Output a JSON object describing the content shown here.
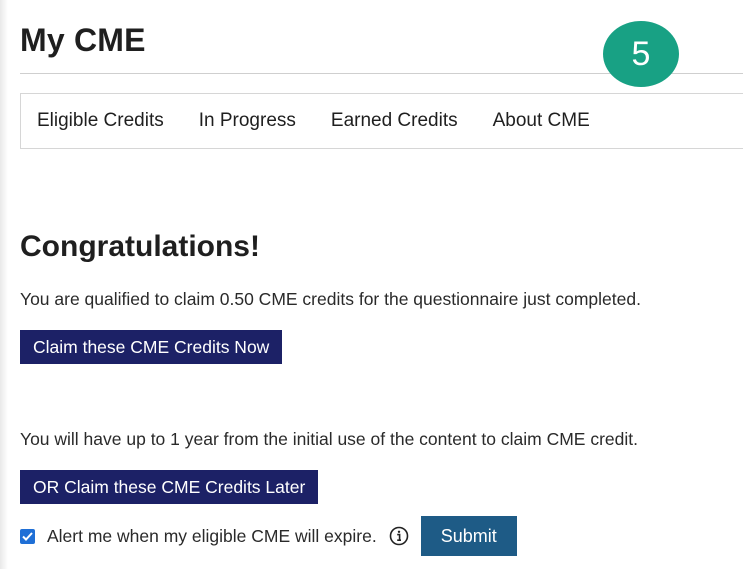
{
  "header": {
    "title": "My CME",
    "step_badge": "5"
  },
  "tabs": [
    {
      "label": "Eligible Credits"
    },
    {
      "label": "In Progress"
    },
    {
      "label": "Earned Credits"
    },
    {
      "label": "About CME"
    }
  ],
  "main": {
    "heading": "Congratulations!",
    "qualified_text": "You are qualified to claim 0.50 CME credits for the questionnaire just completed.",
    "claim_now_label": "Claim these CME Credits Now",
    "year_text": "You will have up to 1 year from the initial use of the content to claim CME credit.",
    "claim_later_label": "OR Claim these CME Credits Later",
    "alert_label": "Alert me when my eligible CME will expire.",
    "alert_checked": true,
    "submit_label": "Submit"
  },
  "icons": {
    "info": "info-circle-icon",
    "checkbox_check": "checkmark-icon"
  },
  "colors": {
    "badge": "#18a184",
    "navy_button": "#1c2166",
    "submit_button": "#1e5b86",
    "checkbox": "#1f6fd6"
  }
}
